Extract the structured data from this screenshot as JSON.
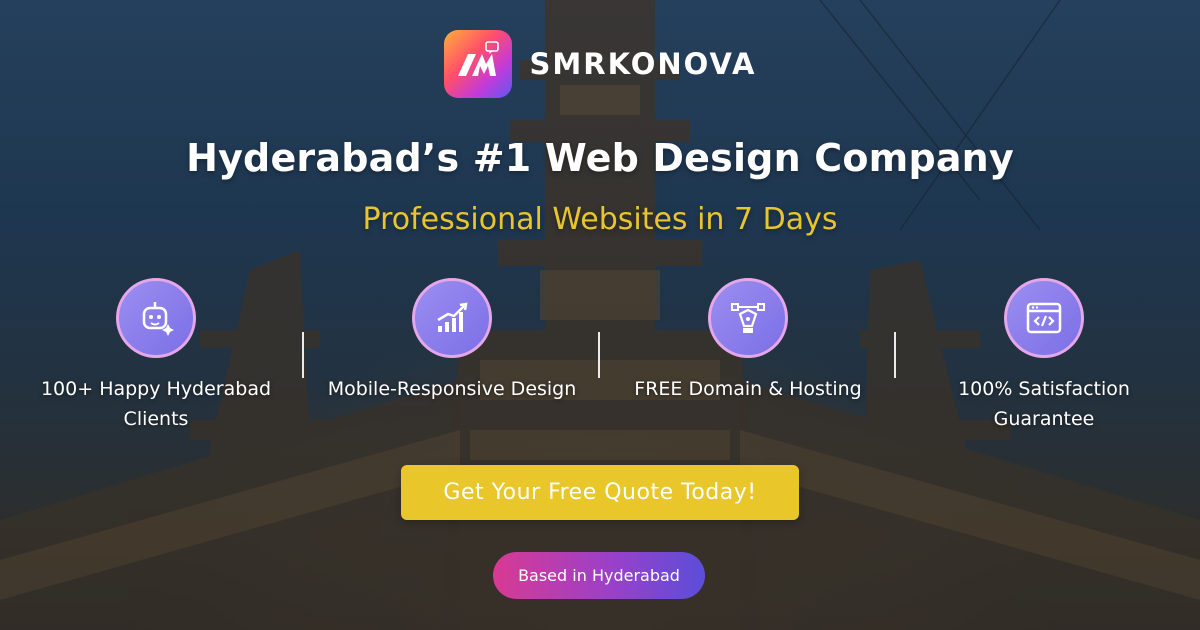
{
  "brand": {
    "name": "SMRKONOVA",
    "logo_letters": "SM",
    "logo_icon": "chat-bubble-icon"
  },
  "headline": "Hyderabad’s #1 Web Design Company",
  "subheadline": "Professional Websites in 7 Days",
  "features": [
    {
      "icon": "robot-sparkle-icon",
      "label": "100+ Happy Hyderabad Clients"
    },
    {
      "icon": "growth-chart-icon",
      "label": "Mobile-Responsive Design"
    },
    {
      "icon": "pen-tool-icon",
      "label": "FREE Domain & Hosting"
    },
    {
      "icon": "code-window-icon",
      "label": "100% Satisfaction Guarantee"
    }
  ],
  "cta_label": "Get Your Free Quote Today!",
  "badge_label": "Based in Hyderabad",
  "colors": {
    "accent_yellow": "#e9c72a",
    "subheadline_yellow": "#e8c52f",
    "icon_circle": "#8577ec",
    "icon_ring": "#e5a6ea",
    "badge_gradient": [
      "#d83a93",
      "#5b4ed8"
    ]
  }
}
